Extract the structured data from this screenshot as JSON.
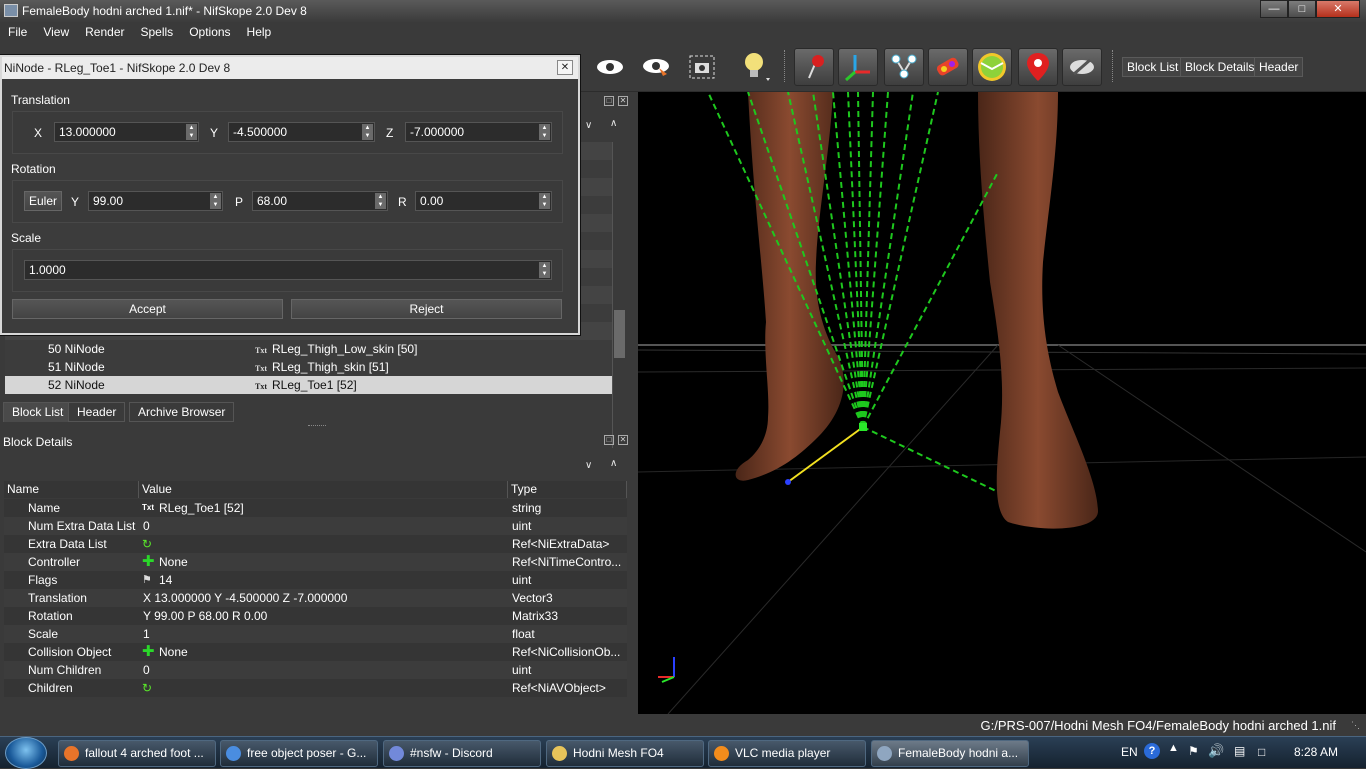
{
  "window": {
    "title": "FemaleBody hodni arched 1.nif* - NifSkope 2.0 Dev 8",
    "min": "—",
    "max": "□",
    "close": "✕"
  },
  "menu": [
    "File",
    "View",
    "Render",
    "Spells",
    "Options",
    "Help"
  ],
  "toolbar": {
    "block_list": "Block List",
    "block_details": "Block Details",
    "header": "Header"
  },
  "dialog": {
    "title": "NiNode - RLeg_Toe1 - NifSkope 2.0 Dev 8",
    "close": "✕",
    "translation_label": "Translation",
    "x_label": "X",
    "x_value": "13.000000",
    "y_label": "Y",
    "y_value": "-4.500000",
    "z_label": "Z",
    "z_value": "-7.000000",
    "rotation_label": "Rotation",
    "euler": "Euler",
    "ry_label": "Y",
    "ry_value": "99.00",
    "p_label": "P",
    "p_value": "68.00",
    "r_label": "R",
    "r_value": "0.00",
    "scale_label": "Scale",
    "scale_value": "1.0000",
    "accept": "Accept",
    "reject": "Reject"
  },
  "tree": {
    "rows": [
      {
        "id": "50 NiNode",
        "name": "RLeg_Thigh_Low_skin [50]"
      },
      {
        "id": "51 NiNode",
        "name": "RLeg_Thigh_skin [51]"
      },
      {
        "id": "52 NiNode",
        "name": "RLeg_Toe1 [52]"
      }
    ],
    "tabs": [
      "Block List",
      "Header",
      "Archive Browser"
    ],
    "txt": "Txt"
  },
  "details": {
    "title": "Block Details",
    "headers": [
      "Name",
      "Value",
      "Type"
    ],
    "rows": [
      {
        "name": "Name",
        "icon": "txt",
        "value": "RLeg_Toe1 [52]",
        "type": "string"
      },
      {
        "name": "Num Extra Data List",
        "icon": "",
        "value": "0",
        "type": "uint"
      },
      {
        "name": "Extra Data List",
        "icon": "link",
        "value": "",
        "type": "Ref<NiExtraData>"
      },
      {
        "name": "Controller",
        "icon": "plus",
        "value": "None",
        "type": "Ref<NiTimeContro..."
      },
      {
        "name": "Flags",
        "icon": "flag",
        "value": "14",
        "type": "uint"
      },
      {
        "name": "Translation",
        "icon": "",
        "value": "X 13.000000 Y -4.500000 Z -7.000000",
        "type": "Vector3"
      },
      {
        "name": "Rotation",
        "icon": "",
        "value": "Y 99.00 P 68.00 R 0.00",
        "type": "Matrix33"
      },
      {
        "name": "Scale",
        "icon": "",
        "value": "1",
        "type": "float"
      },
      {
        "name": "Collision Object",
        "icon": "plus",
        "value": "None",
        "type": "Ref<NiCollisionOb..."
      },
      {
        "name": "Num Children",
        "icon": "",
        "value": "0",
        "type": "uint"
      },
      {
        "name": "Children",
        "icon": "link",
        "value": "",
        "type": "Ref<NiAVObject>"
      }
    ]
  },
  "status": {
    "path": "G:/PRS-007/Hodni Mesh FO4/FemaleBody hodni arched 1.nif"
  },
  "taskbar": {
    "tasks": [
      {
        "label": "fallout 4 arched foot ...",
        "color": "#e8742a"
      },
      {
        "label": "free object poser - G...",
        "color": "#4a8de0"
      },
      {
        "label": "#nsfw - Discord",
        "color": "#7289da"
      },
      {
        "label": "Hodni Mesh FO4",
        "color": "#e8c45a"
      },
      {
        "label": "VLC media player",
        "color": "#f28c1c"
      },
      {
        "label": "FemaleBody hodni a...",
        "color": "#8fa6c0"
      }
    ],
    "lang": "EN",
    "time": "8:28 AM"
  }
}
